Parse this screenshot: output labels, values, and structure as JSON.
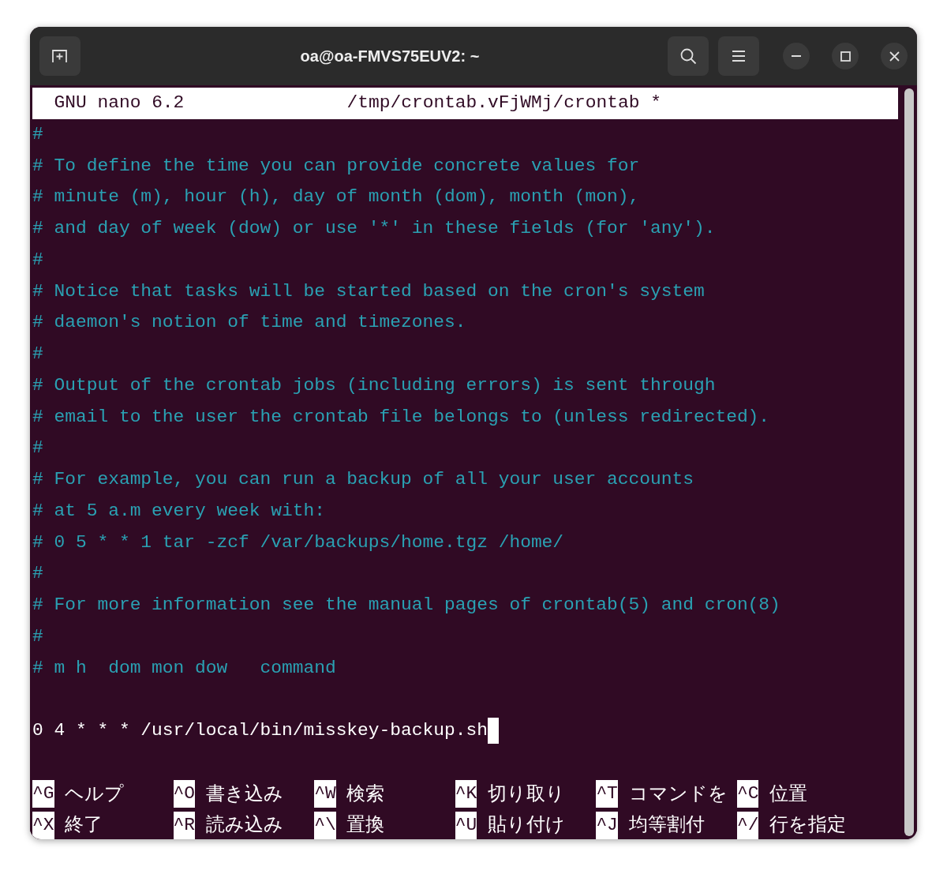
{
  "window": {
    "title": "oa@oa-FMVS75EUV2: ~"
  },
  "nano": {
    "header": {
      "app": "GNU nano 6.2",
      "file": "/tmp/crontab.vFjWMj/crontab *"
    },
    "lines": [
      {
        "kind": "comment",
        "text": "#"
      },
      {
        "kind": "comment",
        "text": "# To define the time you can provide concrete values for"
      },
      {
        "kind": "comment",
        "text": "# minute (m), hour (h), day of month (dom), month (mon),"
      },
      {
        "kind": "comment",
        "text": "# and day of week (dow) or use '*' in these fields (for 'any')."
      },
      {
        "kind": "comment",
        "text": "#"
      },
      {
        "kind": "comment",
        "text": "# Notice that tasks will be started based on the cron's system"
      },
      {
        "kind": "comment",
        "text": "# daemon's notion of time and timezones."
      },
      {
        "kind": "comment",
        "text": "#"
      },
      {
        "kind": "comment",
        "text": "# Output of the crontab jobs (including errors) is sent through"
      },
      {
        "kind": "comment",
        "text": "# email to the user the crontab file belongs to (unless redirected)."
      },
      {
        "kind": "comment",
        "text": "#"
      },
      {
        "kind": "comment",
        "text": "# For example, you can run a backup of all your user accounts"
      },
      {
        "kind": "comment",
        "text": "# at 5 a.m every week with:"
      },
      {
        "kind": "comment",
        "text": "# 0 5 * * 1 tar -zcf /var/backups/home.tgz /home/"
      },
      {
        "kind": "comment",
        "text": "#"
      },
      {
        "kind": "comment",
        "text": "# For more information see the manual pages of crontab(5) and cron(8)"
      },
      {
        "kind": "comment",
        "text": "#"
      },
      {
        "kind": "comment",
        "text": "# m h  dom mon dow   command"
      },
      {
        "kind": "blank"
      },
      {
        "kind": "code",
        "text": "0 4 * * * /usr/local/bin/misskey-backup.sh",
        "cursor": true
      }
    ],
    "shortcuts": [
      [
        {
          "key": "^G",
          "label": "ヘルプ"
        },
        {
          "key": "^O",
          "label": "書き込み"
        },
        {
          "key": "^W",
          "label": "検索"
        },
        {
          "key": "^K",
          "label": "切り取り"
        },
        {
          "key": "^T",
          "label": "コマンドを"
        },
        {
          "key": "^C",
          "label": "位置"
        }
      ],
      [
        {
          "key": "^X",
          "label": "終了"
        },
        {
          "key": "^R",
          "label": "読み込み"
        },
        {
          "key": "^\\",
          "label": "置換"
        },
        {
          "key": "^U",
          "label": "貼り付け"
        },
        {
          "key": "^J",
          "label": "均等割付"
        },
        {
          "key": "^/",
          "label": "行を指定"
        }
      ]
    ]
  }
}
